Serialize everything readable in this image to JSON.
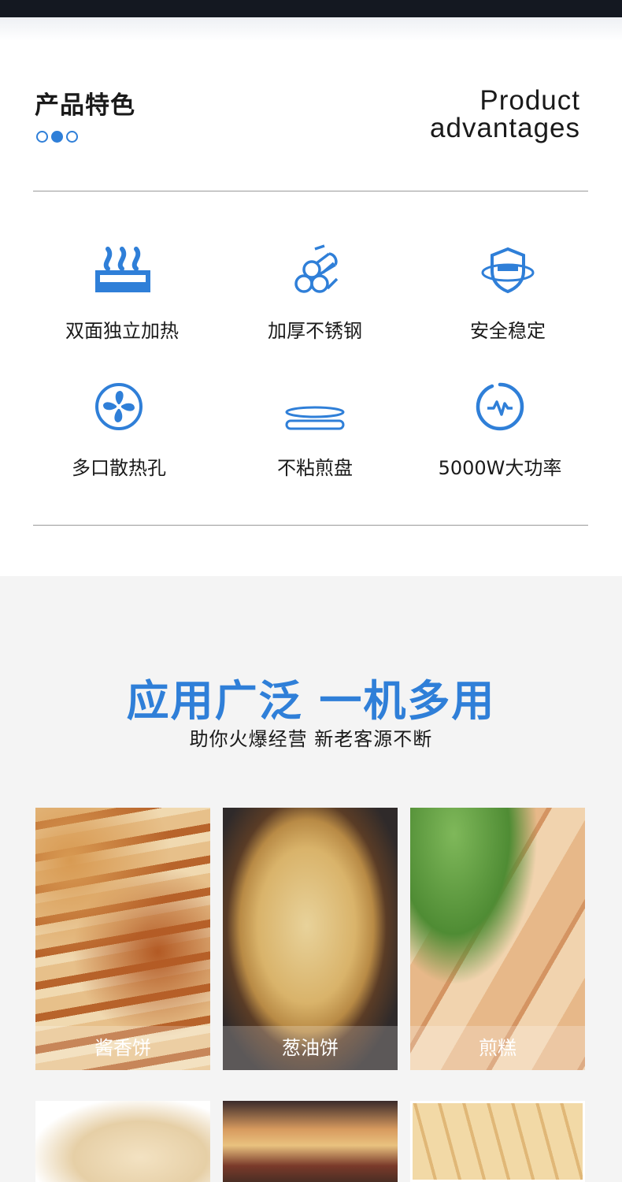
{
  "features_section": {
    "title_cn": "产品特色",
    "title_en_line1": "Product",
    "title_en_line2": "advantages",
    "items": [
      {
        "icon": "heat-waves-icon",
        "label": "双面独立加热"
      },
      {
        "icon": "steel-rods-icon",
        "label": "加厚不锈钢"
      },
      {
        "icon": "shield-icon",
        "label": "安全稳定"
      },
      {
        "icon": "fan-icon",
        "label": "多口散热孔"
      },
      {
        "icon": "pan-icon",
        "label": "不粘煎盘"
      },
      {
        "icon": "power-pulse-icon",
        "label": "5000W大功率"
      }
    ]
  },
  "usage_section": {
    "title": "应用广泛 一机多用",
    "subtitle": "助你火爆经营 新老客源不断",
    "foods": [
      {
        "label": "酱香饼"
      },
      {
        "label": "葱油饼"
      },
      {
        "label": "煎糕"
      }
    ]
  },
  "colors": {
    "accent": "#2f7fd8",
    "topbar": "#141821",
    "section_bg": "#f4f4f4"
  }
}
